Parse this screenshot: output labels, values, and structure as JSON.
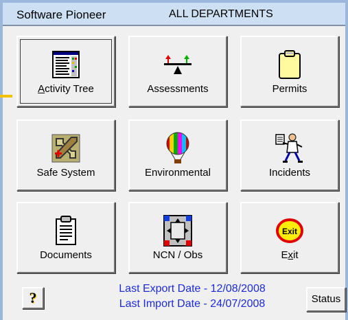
{
  "header": {
    "app_name": "Software Pioneer",
    "department": "ALL DEPARTMENTS"
  },
  "tiles": [
    {
      "label_underlined": "A",
      "label_rest": "ctivity Tree",
      "icon": "activity-tree-icon"
    },
    {
      "label": "Assessments",
      "icon": "balance-scale-icon"
    },
    {
      "label": "Permits",
      "icon": "clipboard-note-icon"
    },
    {
      "label": "Safe System",
      "icon": "tools-icon"
    },
    {
      "label": "Environmental",
      "icon": "hot-air-balloon-icon"
    },
    {
      "label": "Incidents",
      "icon": "running-doctor-icon"
    },
    {
      "label": "Documents",
      "icon": "document-clipboard-icon"
    },
    {
      "label": "NCN / Obs",
      "icon": "ncn-grid-icon"
    },
    {
      "label_before": "E",
      "label_underlined": "x",
      "label_rest": "it",
      "icon": "exit-icon",
      "icon_text": "Exit"
    }
  ],
  "footer": {
    "last_export": "Last Export Date - 12/08/2008",
    "last_import": "Last Import Date - 24/07/2008",
    "status_label": "Status",
    "help_icon": "question-mark-icon"
  },
  "colors": {
    "title_bg": "#cde0f3",
    "frame": "#9bb7d9",
    "footer_text": "#1c2ad8",
    "selector": "#f2c200"
  }
}
